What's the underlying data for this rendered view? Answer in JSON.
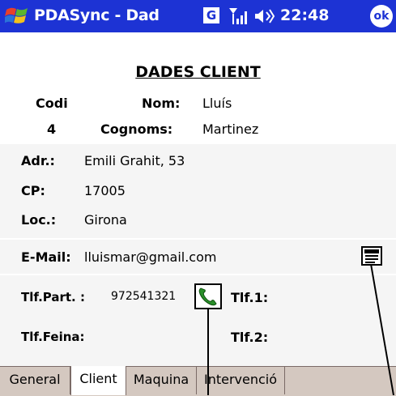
{
  "status_bar": {
    "app_title": "PDASync - Dad",
    "g_icon_label": "G",
    "time": "22:48",
    "ok_label": "ok"
  },
  "header": {
    "title": "DADES CLIENT",
    "codi_label": "Codi",
    "codi_value": "4",
    "nom_label": "Nom:",
    "nom_value": "Lluís",
    "cognoms_label": "Cognoms:",
    "cognoms_value": "Martinez"
  },
  "address": {
    "adr_label": "Adr.:",
    "adr_value": "Emili Grahit, 53",
    "cp_label": "CP:",
    "cp_value": "17005",
    "loc_label": "Loc.:",
    "loc_value": "Girona"
  },
  "email": {
    "label": "E-Mail:",
    "value": "lluismar@gmail.com"
  },
  "phones": {
    "part_label": "Tlf.Part. :",
    "part_value": "972541321",
    "tlf1_label": "Tlf.1:",
    "feina_label": "Tlf.Feina:",
    "tlf2_label": "Tlf.2:"
  },
  "tabs": [
    {
      "label": "General"
    },
    {
      "label": "Client"
    },
    {
      "label": "Maquina"
    },
    {
      "label": "Intervenció"
    }
  ],
  "colors": {
    "titlebar": "#1d33d4",
    "panel": "#f5f5f5",
    "tabbar": "#d4c8c0",
    "phone_icon": "#2a8f2a"
  }
}
